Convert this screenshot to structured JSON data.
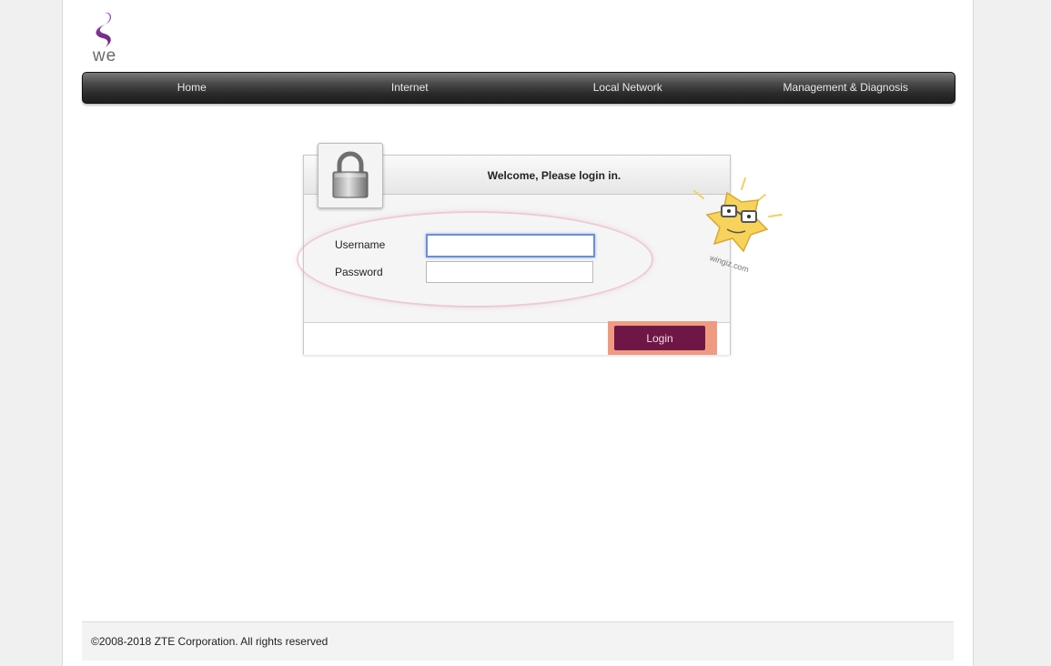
{
  "brand": {
    "logo_text": "we",
    "colors": {
      "primary": "#6e1746",
      "logo_purple": "#7a3a9a"
    }
  },
  "nav": {
    "items": [
      "Home",
      "Internet",
      "Local Network",
      "Management & Diagnosis"
    ]
  },
  "login": {
    "welcome": "Welcome, Please login in.",
    "username_label": "Username",
    "password_label": "Password",
    "username_value": "",
    "password_value": "",
    "login_button": "Login",
    "lock_icon": "padlock-icon"
  },
  "watermark": {
    "text": "wingiz.com"
  },
  "footer": {
    "copyright": "©2008-2018 ZTE Corporation. All rights reserved"
  }
}
